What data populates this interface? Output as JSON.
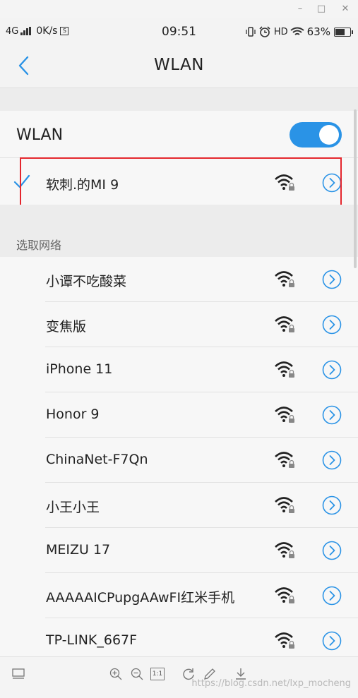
{
  "status_bar": {
    "network": "4G",
    "speed": "0K/s",
    "speed_badge": "S",
    "time": "09:51",
    "hd": "HD",
    "battery": "63%"
  },
  "header": {
    "title": "WLAN"
  },
  "wlan_toggle": {
    "label": "WLAN",
    "state": "on",
    "color": "#2a93e6"
  },
  "connected_network": {
    "name": "软刺.的MI 9"
  },
  "networks_section": {
    "title": "选取网络",
    "items": [
      {
        "name": "小谭不吃酸菜"
      },
      {
        "name": "变焦版"
      },
      {
        "name": "iPhone 11"
      },
      {
        "name": "Honor 9"
      },
      {
        "name": "ChinaNet-F7Qn"
      },
      {
        "name": "小王小王"
      },
      {
        "name": "MEIZU 17"
      },
      {
        "name": "AAAAAICPupgAAwFI红米手机"
      },
      {
        "name": "TP-LINK_667F"
      }
    ]
  },
  "toolbar": {
    "watermark": "https://blog.csdn.net/lxp_mocheng",
    "zoom_label": "1:1"
  },
  "colors": {
    "accent": "#2a93e6",
    "highlight": "#e4262d"
  }
}
